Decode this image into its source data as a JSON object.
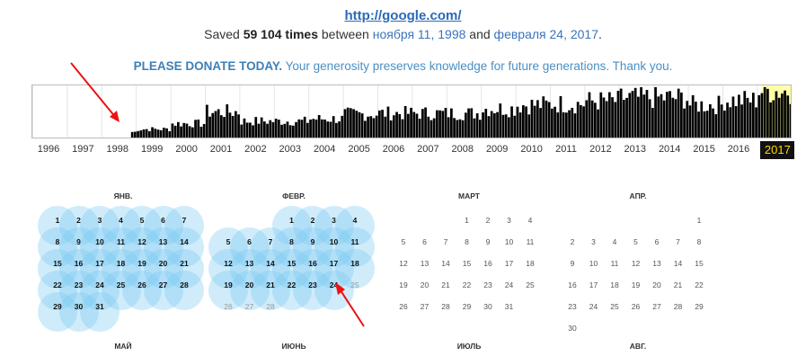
{
  "header": {
    "url": "http://google.com/",
    "saved_prefix": "Saved",
    "saved_count": "59 104 times",
    "between": "between",
    "first_date": "ноября 11, 1998",
    "and": "and",
    "last_date": "февраля 24, 2017",
    "period": ".",
    "donate_bold": "PLEASE DONATE TODAY.",
    "donate_text": "Your generosity preserves knowledge for future generations. Thank you."
  },
  "colors": {
    "link": "#3b73b9",
    "donate": "#4a8fc4",
    "bar": "#000000",
    "selected_year_bg": "#111111",
    "selected_year_text": "#ffd800",
    "highlight": "#ffffaa",
    "bubble": "#78c8f0"
  },
  "timeline": {
    "years": [
      "1996",
      "1997",
      "1998",
      "1999",
      "2000",
      "2001",
      "2002",
      "2003",
      "2004",
      "2005",
      "2006",
      "2007",
      "2008",
      "2009",
      "2010",
      "2011",
      "2012",
      "2013",
      "2014",
      "2015",
      "2016",
      "2017"
    ],
    "selected_year": "2017",
    "yearly_activity": [
      0,
      0,
      0.12,
      0.18,
      0.3,
      0.55,
      0.35,
      0.35,
      0.4,
      0.5,
      0.52,
      0.52,
      0.52,
      0.62,
      0.7,
      0.72,
      0.78,
      0.85,
      0.85,
      0.7,
      0.8,
      1.0
    ]
  },
  "calendar": {
    "months": [
      {
        "name": "ЯНВ.",
        "rows": [
          [
            "",
            "",
            "",
            "",
            "",
            "",
            " "
          ],
          [
            "1",
            "2",
            "3",
            "4",
            "5",
            "6",
            "7"
          ],
          [
            "8",
            "9",
            "10",
            "11",
            "12",
            "13",
            "14"
          ],
          [
            "15",
            "16",
            "17",
            "18",
            "19",
            "20",
            "21"
          ],
          [
            "22",
            "23",
            "24",
            "25",
            "26",
            "27",
            "28"
          ],
          [
            "29",
            "30",
            "31",
            "",
            "",
            "",
            ""
          ]
        ],
        "active": true,
        "active_through": 31
      },
      {
        "name": "ФЕВР.",
        "rows": [
          [
            "",
            "",
            "",
            "",
            "",
            "",
            ""
          ],
          [
            "",
            "",
            "",
            "1",
            "2",
            "3",
            "4"
          ],
          [
            "5",
            "6",
            "7",
            "8",
            "9",
            "10",
            "11"
          ],
          [
            "12",
            "13",
            "14",
            "15",
            "16",
            "17",
            "18"
          ],
          [
            "19",
            "20",
            "21",
            "22",
            "23",
            "24",
            "25"
          ],
          [
            "26",
            "27",
            "28",
            "",
            "",
            "",
            ""
          ]
        ],
        "active": true,
        "active_through": 24
      },
      {
        "name": "МАРТ",
        "rows": [
          [
            "",
            "",
            "",
            "1",
            "2",
            "3",
            "4"
          ],
          [
            "5",
            "6",
            "7",
            "8",
            "9",
            "10",
            "11"
          ],
          [
            "12",
            "13",
            "14",
            "15",
            "16",
            "17",
            "18"
          ],
          [
            "19",
            "20",
            "21",
            "22",
            "23",
            "24",
            "25"
          ],
          [
            "26",
            "27",
            "28",
            "29",
            "30",
            "31",
            ""
          ]
        ],
        "active": false,
        "active_through": 0
      },
      {
        "name": "АПР.",
        "rows": [
          [
            "",
            "",
            "",
            "",
            "",
            "",
            "1"
          ],
          [
            "2",
            "3",
            "4",
            "5",
            "6",
            "7",
            "8"
          ],
          [
            "9",
            "10",
            "11",
            "12",
            "13",
            "14",
            "15"
          ],
          [
            "16",
            "17",
            "18",
            "19",
            "20",
            "21",
            "22"
          ],
          [
            "23",
            "24",
            "25",
            "26",
            "27",
            "28",
            "29"
          ],
          [
            "30",
            "",
            "",
            "",
            "",
            "",
            ""
          ]
        ],
        "active": false,
        "active_through": 0
      }
    ],
    "next_row_months": [
      "МАЙ",
      "ИЮНЬ",
      "ИЮЛЬ",
      "АВГ."
    ]
  }
}
